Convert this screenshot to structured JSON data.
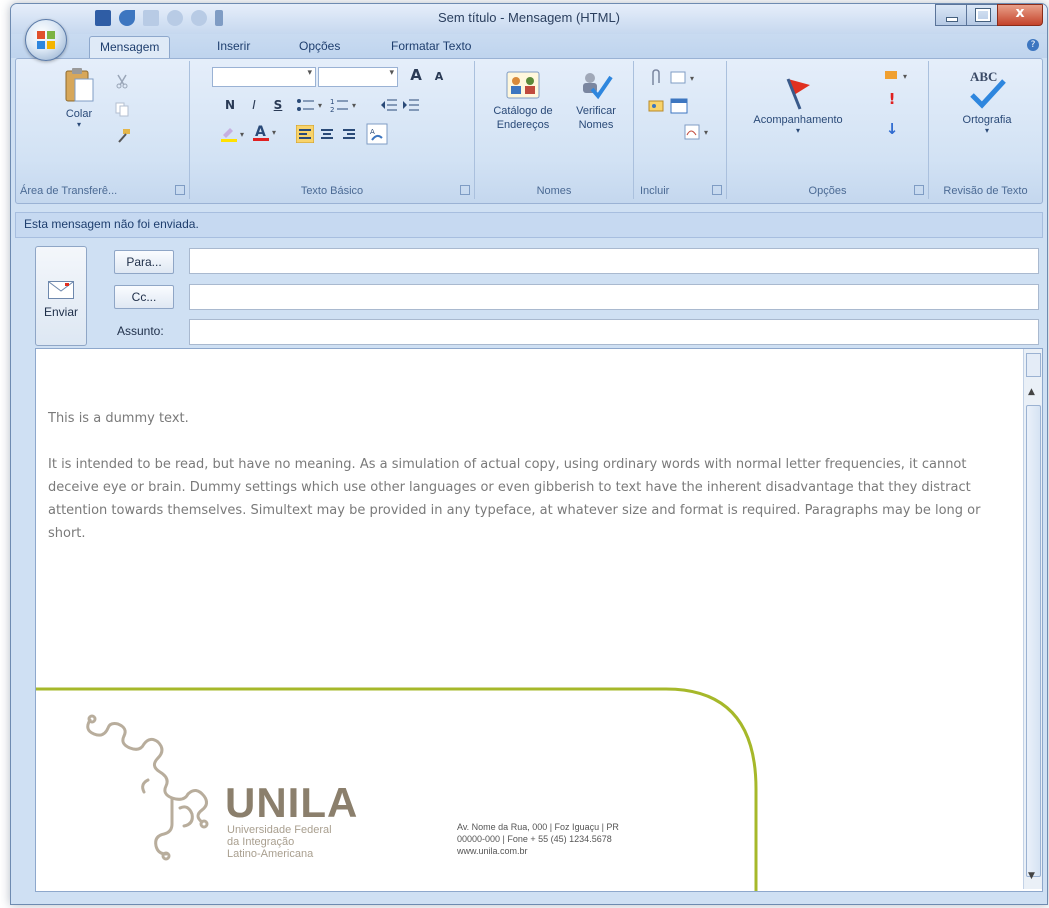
{
  "window": {
    "title": "Sem título - Mensagem (HTML)"
  },
  "tabs": [
    {
      "label": "Mensagem"
    },
    {
      "label": "Inserir"
    },
    {
      "label": "Opções"
    },
    {
      "label": "Formatar Texto"
    }
  ],
  "ribbon": {
    "clipboard": {
      "paste_label": "Colar",
      "group_label": "Área de Transferê..."
    },
    "basic_text": {
      "group_label": "Texto Básico",
      "font_size_grow": "A",
      "font_size_shrink": "A",
      "bold": "N",
      "italic": "I",
      "underline": "S"
    },
    "names": {
      "address_book_label": "Catálogo de Endereços",
      "check_names_label": "Verificar Nomes",
      "group_label": "Nomes"
    },
    "include": {
      "group_label": "Incluir"
    },
    "options": {
      "follow_up_label": "Acompanhamento",
      "group_label": "Opções"
    },
    "proofing": {
      "spelling_label": "Ortografia",
      "spelling_icon_text": "ABC",
      "group_label": "Revisão de Texto"
    }
  },
  "infobar": {
    "text": "Esta mensagem não foi enviada."
  },
  "compose": {
    "send_label": "Enviar",
    "to_button": "Para...",
    "cc_button": "Cc...",
    "subject_label": "Assunto:",
    "to_value": "",
    "cc_value": "",
    "subject_value": ""
  },
  "body": {
    "paragraph1": "This is a dummy text.",
    "paragraph2": "It is intended to be read, but have no meaning. As a simulation of actual copy, using ordinary words with normal letter frequencies, it cannot deceive eye or brain. Dummy settings which use other languages or even gibberish to text have the inherent disadvantage that they distract attention towards themselves. Simultext may be provided in any typeface, at whatever size and format is required. Paragraphs may be long or short."
  },
  "footer": {
    "org_name": "UNILA",
    "org_line1": "Universidade Federal",
    "org_line2": "da Integração",
    "org_line3": "Latino-Americana",
    "address_line1": "Av. Nome da Rua, 000 | Foz Iguaçu | PR",
    "address_line2": "00000-000 | Fone + 55 (45) 1234.5678",
    "address_line3": "www.unila.com.br"
  },
  "colors": {
    "accent_green": "#a6b82a",
    "brand_taupe": "#8b7f6c"
  }
}
